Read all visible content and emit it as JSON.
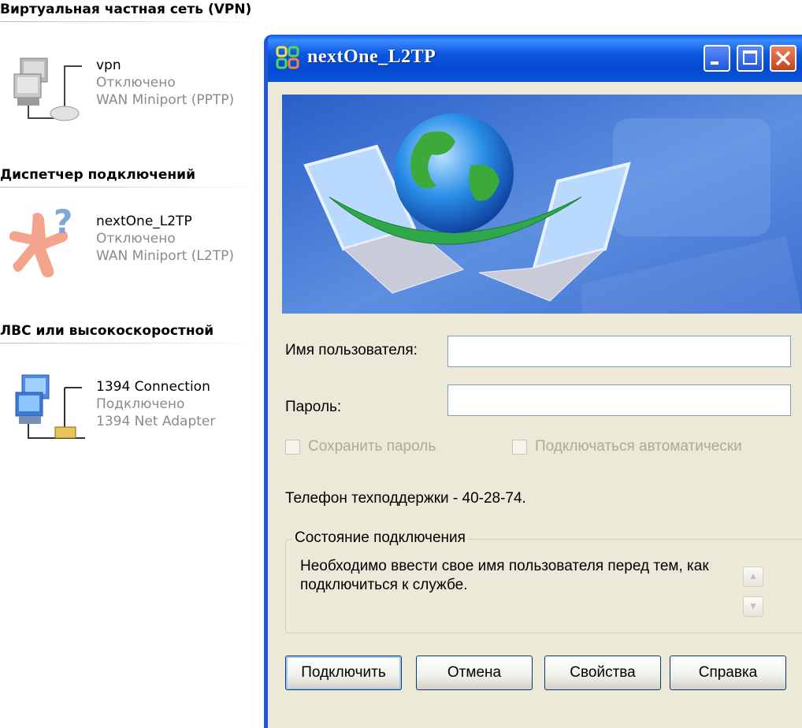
{
  "explorer": {
    "groups": [
      {
        "header": "Виртуальная частная сеть (VPN)",
        "connection": {
          "name": "vpn",
          "status": "Отключено",
          "device": "WAN Miniport (PPTP)"
        }
      },
      {
        "header": "Диспетчер подключений",
        "connection": {
          "name": "nextOne_L2TP",
          "status": "Отключено",
          "device": "WAN Miniport (L2TP)"
        }
      },
      {
        "header": "ЛВС или высокоскоростной",
        "connection": {
          "name": "1394 Connection",
          "status": "Подключено",
          "device": "1394 Net Adapter"
        }
      }
    ]
  },
  "dialog": {
    "title": "nextOne_L2TP",
    "username_label": "Имя пользователя:",
    "username_value": "",
    "password_label": "Пароль:",
    "password_value": "",
    "save_password_label": "Сохранить пароль",
    "auto_connect_label": "Подключаться автоматически",
    "support_phone": "Телефон техподдержки - 40-28-74.",
    "status_group_label": "Состояние подключения",
    "status_message": "Необходимо ввести свое имя пользователя перед тем, как подключиться к службе.",
    "buttons": {
      "connect": "Подключить",
      "cancel": "Отмена",
      "properties": "Свойства",
      "help": "Справка"
    }
  },
  "colors": {
    "titlebar": "#0b57e0",
    "dialog_bg": "#ece9d8",
    "disabled_text": "#acaa99",
    "close_button": "#c4421a"
  },
  "icons": {
    "vpn": "network-computers-icon",
    "cm": "connection-manager-icon",
    "lan": "lan-connection-icon",
    "title": "connection-manager-small-icon",
    "banner": "globe-laptops-banner"
  }
}
